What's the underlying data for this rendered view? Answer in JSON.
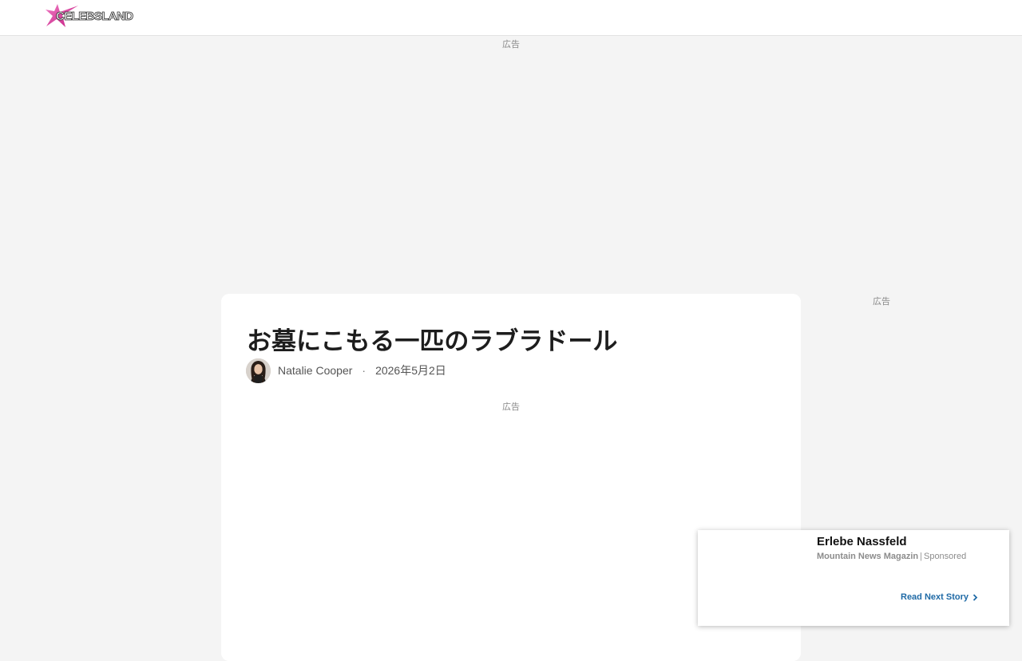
{
  "header": {
    "logo_text": "CELEBSLAND",
    "brand_color": "#d63aa0"
  },
  "ads": {
    "top_label": "広告",
    "side_label": "広告",
    "inline_label": "広告"
  },
  "article": {
    "title": "お墓にこもる一匹のラブラドール",
    "author": "Natalie Cooper",
    "separator": "·",
    "date": "2026年5月2日"
  },
  "sponsored": {
    "title": "Erlebe Nassfeld",
    "source": "Mountain News Magazin",
    "separator": "|",
    "label": "Sponsored",
    "cta": "Read Next Story",
    "cta_color": "#1f6aa6"
  }
}
